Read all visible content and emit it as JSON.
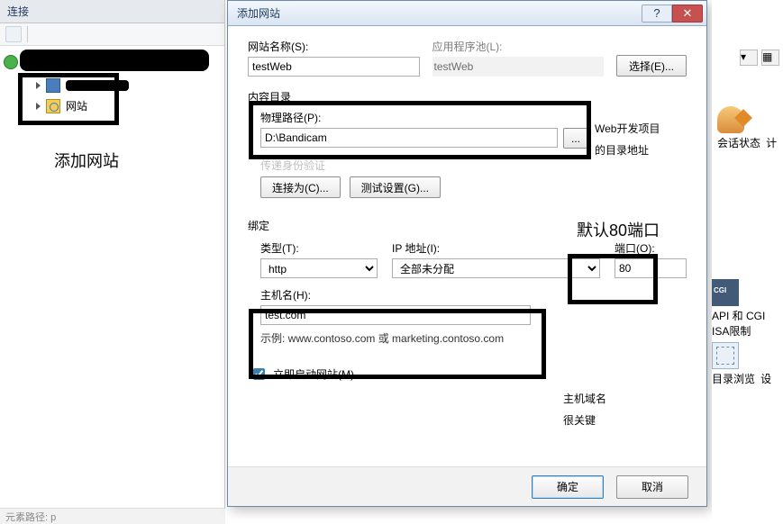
{
  "left_panel": {
    "title": "连接",
    "tree": {
      "sites_label": "网站"
    }
  },
  "dialog": {
    "title": "添加网站",
    "fields": {
      "site_name_label": "网站名称(S):",
      "site_name_value": "testWeb",
      "app_pool_label": "应用程序池(L):",
      "app_pool_value": "testWeb",
      "select_btn": "选择(E)...",
      "content_dir_legend": "内容目录",
      "phys_path_label": "物理路径(P):",
      "phys_path_value": "D:\\Bandicam",
      "browse_btn": "...",
      "passthru_legend": "传递身份验证",
      "connect_as_btn": "连接为(C)...",
      "test_settings_btn": "测试设置(G)...",
      "binding_legend": "绑定",
      "type_label": "类型(T):",
      "type_value": "http",
      "ip_label": "IP 地址(I):",
      "ip_value": "全部未分配",
      "port_label": "端口(O):",
      "port_value": "80",
      "host_label": "主机名(H):",
      "host_value": "test.com",
      "example_text": "示例: www.contoso.com 或 marketing.contoso.com",
      "start_now_label": "立即启动网站(M)",
      "ok_btn": "确定",
      "cancel_btn": "取消"
    }
  },
  "annotations": {
    "left": "添加网站",
    "path": "Web开发项目的目录地址",
    "port": "默认80端口",
    "host": "主机域名很关键"
  },
  "right": {
    "session_state": "会话状态",
    "calc": "计",
    "cgi": "API 和 CGI ISA限制",
    "dir_browse": "目录浏览",
    "setting": "设"
  },
  "statusbar": "元素路径: p"
}
